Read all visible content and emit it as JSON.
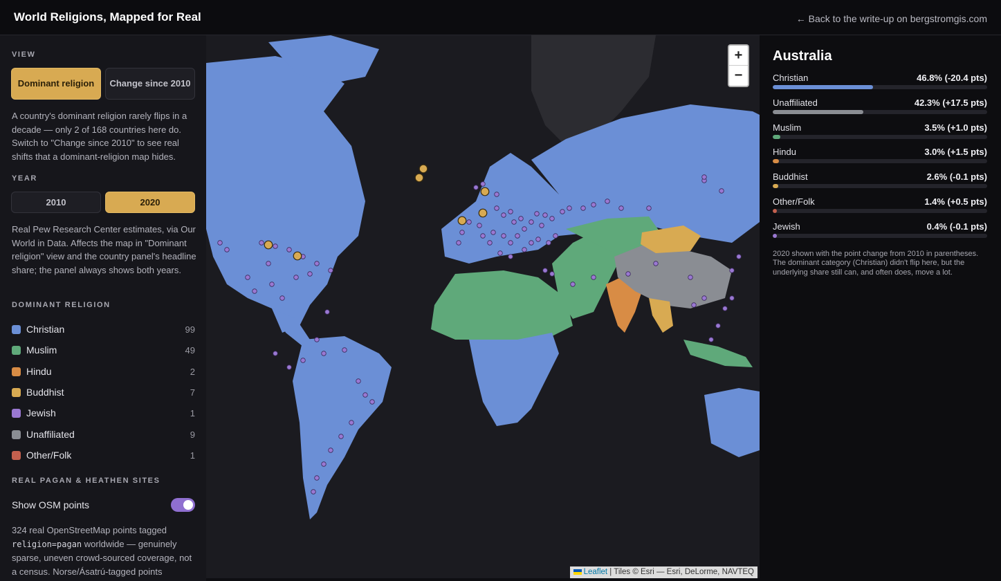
{
  "header": {
    "title": "World Religions, Mapped for Real",
    "back_link": "← Back to the write-up on bergstromgis.com"
  },
  "sidebar": {
    "view": {
      "heading": "VIEW",
      "buttons": [
        {
          "label": "Dominant religion",
          "active": true
        },
        {
          "label": "Change since 2010",
          "active": false
        }
      ],
      "description": "A country's dominant religion rarely flips in a decade — only 2 of 168 countries here do. Switch to \"Change since 2010\" to see real shifts that a dominant-religion map hides."
    },
    "year": {
      "heading": "YEAR",
      "buttons": [
        {
          "label": "2010",
          "active": false
        },
        {
          "label": "2020",
          "active": true
        }
      ],
      "description": "Real Pew Research Center estimates, via Our World in Data. Affects the map in \"Dominant religion\" view and the country panel's headline share; the panel always shows both years."
    },
    "legend": {
      "heading": "DOMINANT RELIGION",
      "items": [
        {
          "label": "Christian",
          "count": "99",
          "color": "#6b8fd6"
        },
        {
          "label": "Muslim",
          "count": "49",
          "color": "#5fa97a"
        },
        {
          "label": "Hindu",
          "count": "2",
          "color": "#d88c45"
        },
        {
          "label": "Buddhist",
          "count": "7",
          "color": "#d8aa52"
        },
        {
          "label": "Jewish",
          "count": "1",
          "color": "#9a78d2"
        },
        {
          "label": "Unaffiliated",
          "count": "9",
          "color": "#8a8d93"
        },
        {
          "label": "Other/Folk",
          "count": "1",
          "color": "#c4604e"
        }
      ]
    },
    "pagan": {
      "heading": "REAL PAGAN & HEATHEN SITES",
      "toggle_label": "Show OSM points",
      "toggle_on": true,
      "desc_before": "324 real OpenStreetMap points tagged ",
      "desc_code": "religion=pagan",
      "desc_after": " worldwide — genuinely sparse, uneven crowd-sourced coverage, not a census. Norse/Ásatrú-tagged points"
    }
  },
  "map": {
    "zoom_in": "+",
    "zoom_out": "−",
    "attribution_link": "Leaflet",
    "attribution_text": "| Tiles © Esri — Esri, DeLorme, NAVTEQ",
    "colors": {
      "ocean": "#1b1b20",
      "christian": "#6b8fd6",
      "muslim": "#5fa97a",
      "hindu": "#d88c45",
      "buddhist": "#d8aa52",
      "unaffiliated": "#8a8d93",
      "base_land": "#2c2c31",
      "pagan_point": "#9a78d2",
      "norse_point": "#d8aa52"
    }
  },
  "panel": {
    "country": "Australia",
    "stats": [
      {
        "label": "Christian",
        "value": "46.8% (-20.4 pts)",
        "share": 46.8,
        "color": "#6b8fd6"
      },
      {
        "label": "Unaffiliated",
        "value": "42.3% (+17.5 pts)",
        "share": 42.3,
        "color": "#8a8d93"
      },
      {
        "label": "Muslim",
        "value": "3.5% (+1.0 pts)",
        "share": 3.5,
        "color": "#5fa97a"
      },
      {
        "label": "Hindu",
        "value": "3.0% (+1.5 pts)",
        "share": 3.0,
        "color": "#d88c45"
      },
      {
        "label": "Buddhist",
        "value": "2.6% (-0.1 pts)",
        "share": 2.6,
        "color": "#d8aa52"
      },
      {
        "label": "Other/Folk",
        "value": "1.4% (+0.5 pts)",
        "share": 1.4,
        "color": "#c4604e"
      },
      {
        "label": "Jewish",
        "value": "0.4% (-0.1 pts)",
        "share": 0.4,
        "color": "#9a78d2"
      }
    ],
    "note": "2020 shown with the point change from 2010 in parentheses. The dominant category (Christian) didn't flip here, but the underlying share still can, and often does, move a lot."
  }
}
